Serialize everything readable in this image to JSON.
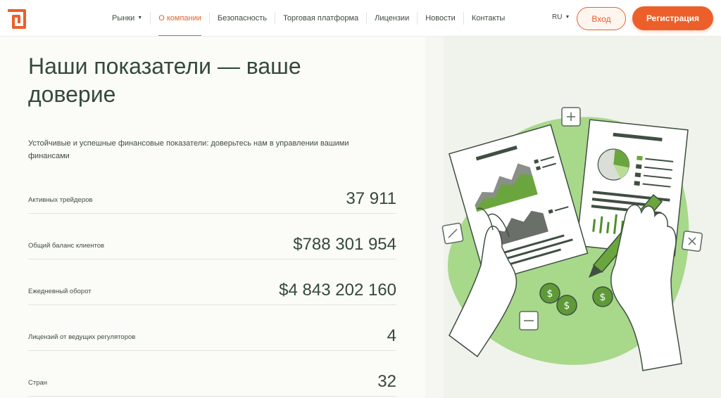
{
  "header": {
    "nav": [
      {
        "label": "Рынки",
        "has_dropdown": true
      },
      {
        "label": "О компании",
        "active": true
      },
      {
        "label": "Безопасность"
      },
      {
        "label": "Торговая платформа"
      },
      {
        "label": "Лицензии"
      },
      {
        "label": "Новости"
      },
      {
        "label": "Контакты"
      }
    ],
    "language": "RU",
    "login_label": "Вход",
    "register_label": "Регистрация"
  },
  "main": {
    "title": "Наши показатели — ваше доверие",
    "subtitle": "Устойчивые и успешные финансовые показатели: доверьтесь нам в управлении вашими финансами",
    "stats": [
      {
        "label": "Активных трейдеров",
        "value": "37 911"
      },
      {
        "label": "Общий баланс клиентов",
        "value": "$788 301 954"
      },
      {
        "label": "Ежедневный оборот",
        "value": "$4 843 202 160"
      },
      {
        "label": "Лицензий от ведущих регуляторов",
        "value": "4"
      },
      {
        "label": "Стран",
        "value": "32"
      }
    ]
  },
  "colors": {
    "accent": "#ec5f2a",
    "text_dark": "#34493a",
    "illustration_green": "#9fd47a",
    "illustration_dark_green": "#4f8f2a"
  }
}
